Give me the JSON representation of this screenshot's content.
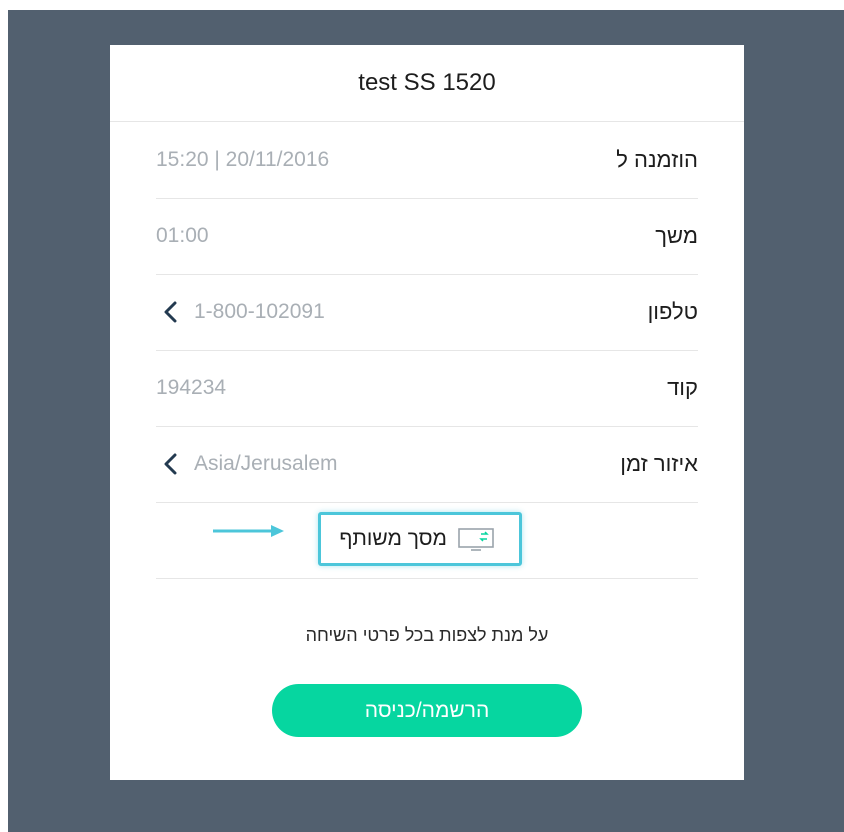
{
  "meeting": {
    "title": "test SS 1520"
  },
  "details": {
    "scheduled": {
      "label": "הוזמנה ל",
      "value": "15:20 | 20/11/2016"
    },
    "duration": {
      "label": "משך",
      "value": "01:00"
    },
    "phone": {
      "label": "טלפון",
      "value": "1-800-102091"
    },
    "code": {
      "label": "קוד",
      "value": "194234"
    },
    "timezone": {
      "label": "איזור זמן",
      "value": "Asia/Jerusalem"
    }
  },
  "screen_share": {
    "label": "מסך משותף",
    "icon": "screen-share-icon"
  },
  "annotation": {
    "arrow_color": "#4cc6da",
    "highlight_color": "#4cc6da"
  },
  "info_text": "על מנת לצפות בכל פרטי השיחה",
  "login_button": {
    "label": "הרשמה/כניסה",
    "color": "#06d6a0"
  }
}
